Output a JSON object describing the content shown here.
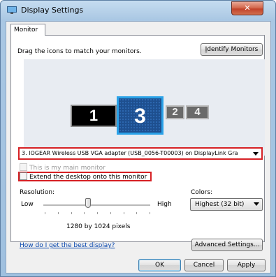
{
  "window": {
    "title": "Display Settings",
    "close_label": "✕"
  },
  "tabs": [
    {
      "label": "Monitor"
    }
  ],
  "monitor_tab": {
    "instruction": "Drag the icons to match your monitors.",
    "identify_button": "Identify Monitors",
    "monitors": [
      {
        "number": "1",
        "state": "active"
      },
      {
        "number": "3",
        "state": "selected"
      },
      {
        "number": "2",
        "state": "inactive"
      },
      {
        "number": "4",
        "state": "inactive"
      }
    ],
    "display_select": {
      "value": "3. IOGEAR Wireless USB VGA adapter (USB_0056-T00003) on DisplayLink Gra"
    },
    "main_monitor_checkbox": {
      "label": "This is my main monitor",
      "checked": false,
      "enabled": false
    },
    "extend_checkbox": {
      "label": "Extend the desktop onto this monitor",
      "checked": false,
      "enabled": true
    },
    "resolution": {
      "label": "Resolution:",
      "low_label": "Low",
      "high_label": "High",
      "value": "1280 by 1024 pixels",
      "slider_level": 0.4
    },
    "colors": {
      "label": "Colors:",
      "value": "Highest (32 bit)"
    },
    "help_link": "How do I get the best display?",
    "advanced_button": "Advanced Settings..."
  },
  "buttons": {
    "ok": "OK",
    "cancel": "Cancel",
    "apply": "Apply"
  },
  "colors_theme": {
    "highlight_box": "#d62024",
    "selected_monitor_border": "#2aa2e8",
    "link": "#0645ad"
  }
}
